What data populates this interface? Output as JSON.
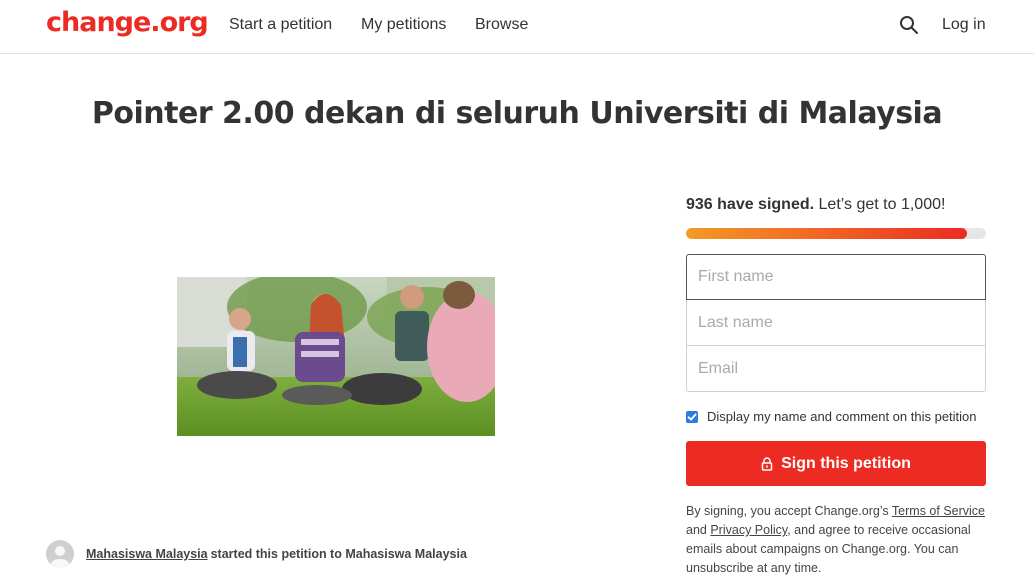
{
  "header": {
    "logo": "change.org",
    "nav": [
      "Start a petition",
      "My petitions",
      "Browse"
    ],
    "login": "Log in"
  },
  "petition": {
    "title": "Pointer 2.00 dekan di seluruh Universiti di Malaysia"
  },
  "signatures": {
    "count_text": "936 have signed.",
    "goal_text": "Let’s get to 1,000!",
    "progress": 0.936
  },
  "form": {
    "first_name_placeholder": "First name",
    "last_name_placeholder": "Last name",
    "email_placeholder": "Email",
    "display_checkbox_label": "Display my name and comment on this petition",
    "display_checked": true,
    "sign_button": "Sign this petition"
  },
  "legal": {
    "part1": "By signing, you accept Change.org’s ",
    "terms": "Terms of Service",
    "part2": " and ",
    "privacy": "Privacy Policy",
    "part3": ", and agree to receive occasional emails about campaigns on Change.org. You can unsubscribe at any time."
  },
  "starter": {
    "name": "Mahasiswa Malaysia",
    "text": "started this petition to Mahasiswa Malaysia"
  },
  "colors": {
    "brand": "#ec2c22",
    "progress_start": "#f49a26",
    "checkbox": "#2d7de0"
  }
}
